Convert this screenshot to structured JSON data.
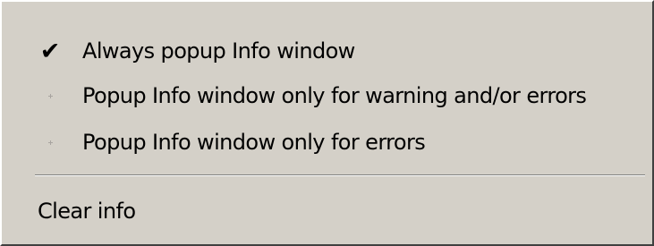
{
  "menu": {
    "items": [
      {
        "label": "Always popup Info window",
        "checked": true,
        "marker_icon": "checkmark-icon"
      },
      {
        "label": "Popup Info window only for warning and/or errors",
        "checked": false,
        "marker_icon": "dot-icon"
      },
      {
        "label": "Popup Info window only for errors",
        "checked": false,
        "marker_icon": "dot-icon"
      }
    ],
    "clear_label": "Clear info",
    "check_glyph": "✔",
    "colors": {
      "background": "#d4d0c8",
      "text": "#000000",
      "inactive_marker": "#a8a4a0",
      "separator_dark": "#808080",
      "separator_light": "#ffffff"
    }
  }
}
